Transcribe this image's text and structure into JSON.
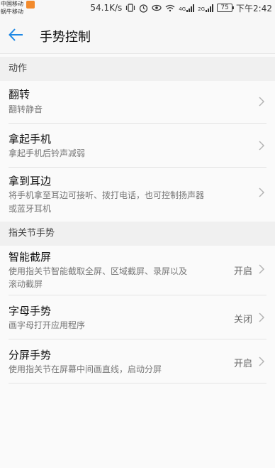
{
  "status_bar": {
    "carrier1": "中国移动",
    "carrier2": "蜗牛移动",
    "speed": "54.1K/s",
    "signal1": "4G",
    "signal2": "2G",
    "battery": "75",
    "time": "下午2:42"
  },
  "header": {
    "title": "手势控制"
  },
  "sections": [
    {
      "label": "动作",
      "items": [
        {
          "title": "翻转",
          "subtitle": "翻转静音"
        },
        {
          "title": "拿起手机",
          "subtitle": "拿起手机后铃声减弱"
        },
        {
          "title": "拿到耳边",
          "subtitle_line1": "将手机拿至耳边可接听、拨打电话，也可控制扬声器",
          "subtitle_line2": "或蓝牙耳机"
        }
      ]
    },
    {
      "label": "指关节手势",
      "items": [
        {
          "title": "智能截屏",
          "subtitle_line1": "使用指关节智能截取全屏、区域截屏、录屏以及",
          "subtitle_line2": "滚动截屏",
          "value": "开启"
        },
        {
          "title": "字母手势",
          "subtitle": "画字母打开应用程序",
          "value": "关闭"
        },
        {
          "title": "分屏手势",
          "subtitle": "使用指关节在屏幕中间画直线，启动分屏",
          "value": "开启"
        }
      ]
    }
  ],
  "icons": {
    "back": "back-arrow-icon",
    "chevron": "chevron-right-icon"
  },
  "colors": {
    "accent": "#1e88e5",
    "section_bg": "#f0f0f0",
    "background": "#fafafa"
  }
}
